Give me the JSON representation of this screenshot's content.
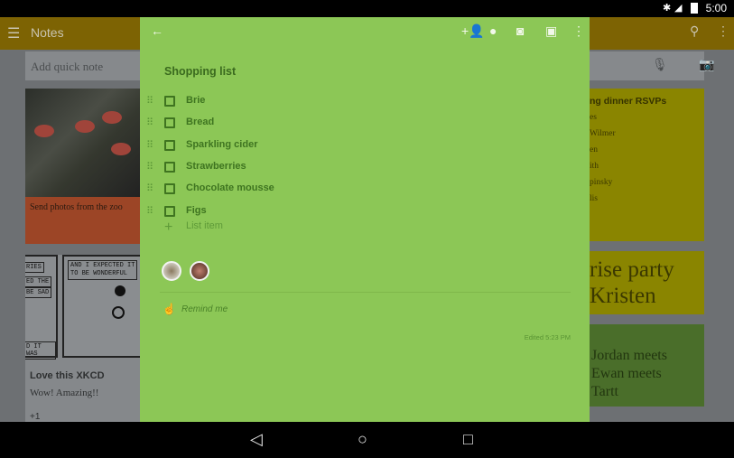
{
  "status_bar": {
    "time": "5:00",
    "icons": [
      "bluetooth-icon",
      "signal-icon",
      "battery-icon"
    ]
  },
  "app_bar": {
    "title": "Notes",
    "icons": [
      "menu-icon",
      "search-icon",
      "more-vert-icon"
    ]
  },
  "quick_note": {
    "placeholder": "Add quick note",
    "icons": [
      "mic-icon",
      "camera-icon"
    ]
  },
  "background_notes": {
    "zoo": {
      "caption": "Send photos from the zoo"
    },
    "xkcd": {
      "bubbles": [
        "RIES",
        "ED THE",
        "BE SAD",
        "AND I EXPECTED IT",
        "TO BE WONDERFUL",
        "D IT WAS"
      ],
      "title": "Love this XKCD",
      "body": "Wow! Amazing!!",
      "plus": "+1"
    },
    "rsvp": {
      "title": "ng dinner RSVPs",
      "items": [
        "es",
        "Wilmer",
        "en",
        "ith",
        "pinsky",
        "lis"
      ]
    },
    "party": {
      "lines": [
        "rise party",
        "Kristen"
      ]
    },
    "jordan": {
      "lines": [
        "Jordan meets",
        "Ewan meets",
        "Tartt"
      ]
    }
  },
  "note": {
    "color": "#8cc756",
    "toolbar_icons": [
      "back-arrow-icon",
      "add-collaborator-icon",
      "palette-icon",
      "camera-icon",
      "archive-icon",
      "more-vert-icon"
    ],
    "title": "Shopping list",
    "items": [
      {
        "label": "Brie",
        "checked": false
      },
      {
        "label": "Bread",
        "checked": false
      },
      {
        "label": "Sparkling cider",
        "checked": false
      },
      {
        "label": "Strawberries",
        "checked": false
      },
      {
        "label": "Chocolate mousse",
        "checked": false
      },
      {
        "label": "Figs",
        "checked": false
      }
    ],
    "add_item": "List item",
    "remind": "Remind me",
    "edited": "Edited 5:23 PM"
  },
  "nav_bar": {
    "icons": [
      "back-icon",
      "home-icon",
      "recents-icon"
    ]
  }
}
